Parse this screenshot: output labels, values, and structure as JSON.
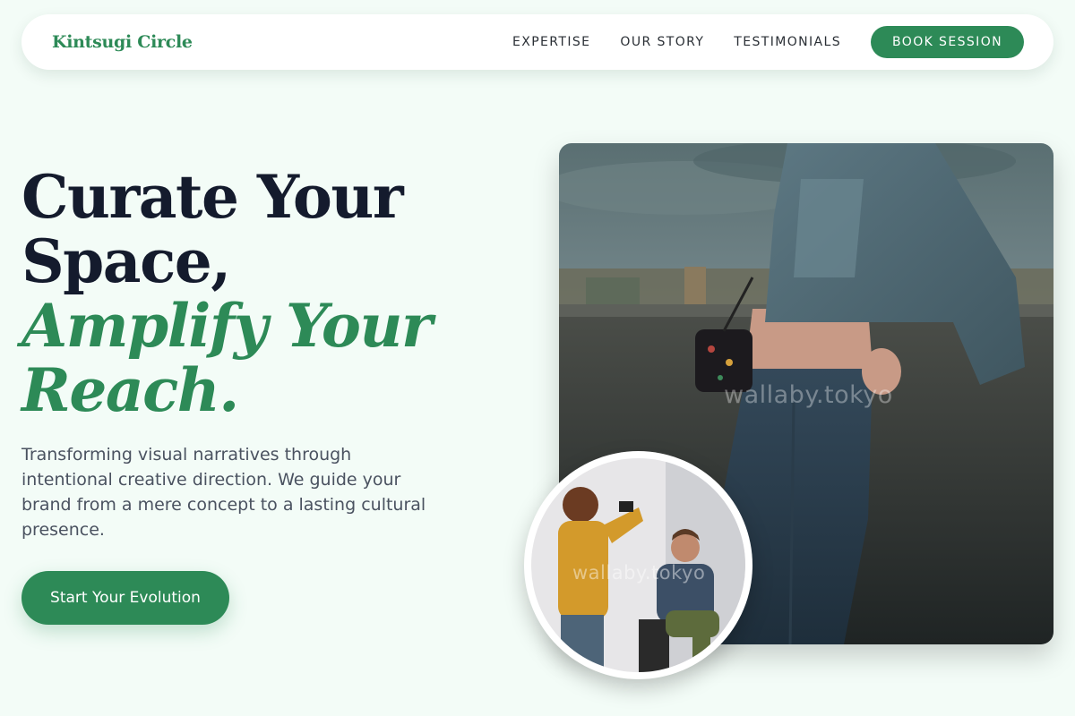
{
  "header": {
    "logo": "Kintsugi Circle",
    "nav": [
      {
        "label": "EXPERTISE"
      },
      {
        "label": "OUR STORY"
      },
      {
        "label": "TESTIMONIALS"
      }
    ],
    "cta_label": "BOOK SESSION"
  },
  "hero": {
    "headline_line1": "Curate Your",
    "headline_line2": "Space,",
    "headline_accent1": "Amplify Your",
    "headline_accent2": "Reach.",
    "subtext": "Transforming visual narratives through intentional creative direction. We guide your brand from a mere concept to a lasting cultural presence.",
    "cta_label": "Start Your Evolution"
  },
  "images": {
    "main_watermark": "wallaby.tokyo",
    "circle_watermark": "wallaby.tokyo"
  },
  "colors": {
    "accent": "#2d8a57",
    "background": "#f3fcf7",
    "heading": "#141b2d",
    "body_text": "#4a5260"
  }
}
